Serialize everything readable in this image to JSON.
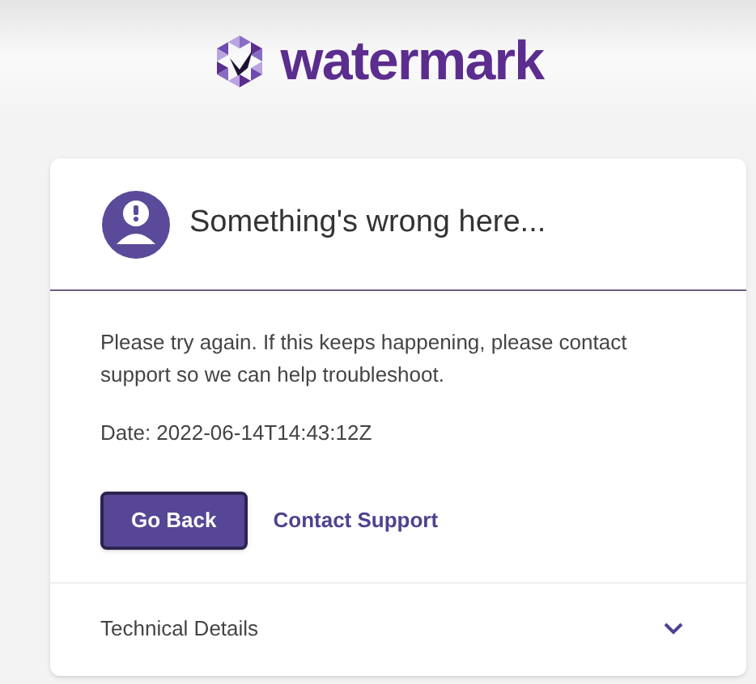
{
  "header": {
    "logo_text": "watermark"
  },
  "error_card": {
    "title": "Something's wrong here...",
    "message": "Please try again. If this keeps happening, please contact support so we can help troubleshoot.",
    "date": "Date: 2022-06-14T14:43:12Z",
    "buttons": [
      {
        "kind": "primary",
        "label": "Go Back"
      },
      {
        "kind": "link",
        "label": "Contact Support"
      }
    ],
    "technical_details": {
      "label": "Technical Details",
      "expanded": false
    }
  }
}
